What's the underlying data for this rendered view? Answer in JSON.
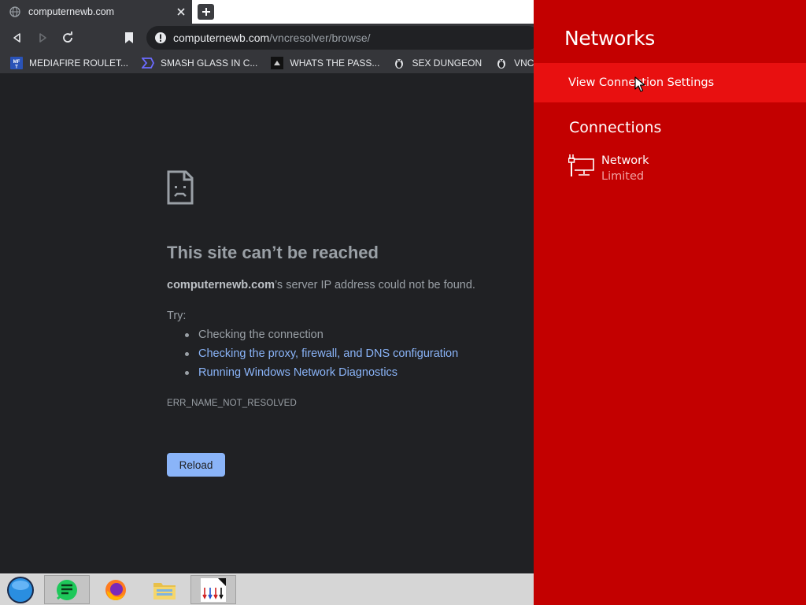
{
  "browser": {
    "tab": {
      "title": "computernewb.com"
    },
    "omnibox": {
      "host": "computernewb.com",
      "path": "/vncresolver/browse/"
    },
    "bookmarks": [
      {
        "label": "MEDIAFIRE ROULET...",
        "icon": "mediafire-icon"
      },
      {
        "label": "SMASH GLASS IN C...",
        "icon": "visual-studio-icon"
      },
      {
        "label": "WHATS THE PASS...",
        "icon": "dark-square-icon"
      },
      {
        "label": "SEX DUNGEON",
        "icon": "tux-icon"
      },
      {
        "label": "VNC FUN",
        "icon": "tux-icon"
      }
    ],
    "error": {
      "title": "This site can’t be reached",
      "host": "computernewb.com",
      "description_suffix": "’s server IP address could not be found.",
      "try_label": "Try:",
      "suggestions": [
        "Checking the connection",
        "Checking the proxy, firewall, and DNS configuration",
        "Running Windows Network Diagnostics"
      ],
      "code": "ERR_NAME_NOT_RESOLVED",
      "reload_label": "Reload"
    }
  },
  "taskbar": {
    "items": [
      "start-orb-icon",
      "notes-app-icon",
      "firefox-icon",
      "file-explorer-icon",
      "arrows-app-icon"
    ]
  },
  "networks_panel": {
    "title": "Networks",
    "settings_label": "View Connection Settings",
    "connections_heading": "Connections",
    "connection": {
      "name": "Network",
      "status": "Limited",
      "icon": "wired-network-icon"
    }
  },
  "colors": {
    "panel_bg": "#c30000",
    "panel_highlight": "#e81010",
    "browser_bg": "#202124",
    "link": "#8ab4f8"
  }
}
